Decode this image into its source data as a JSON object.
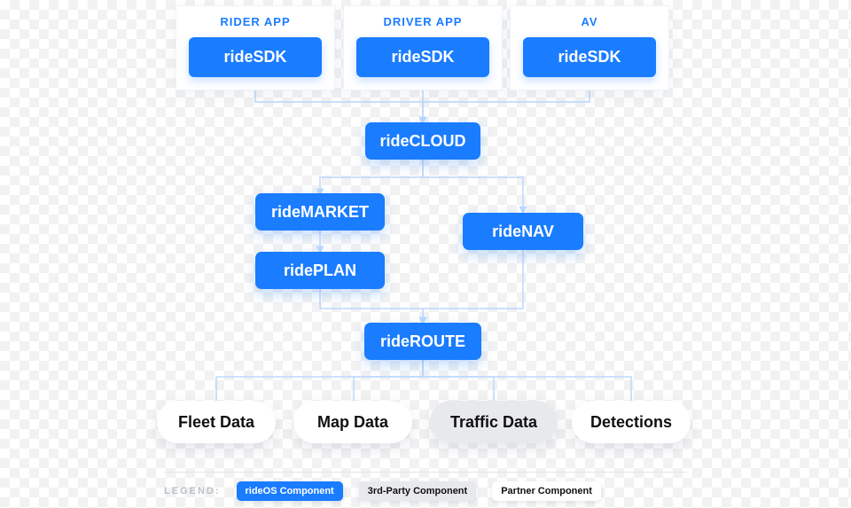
{
  "colors": {
    "primary": "#1a7cff",
    "connector": "#bcd8ff",
    "pillMuted": "#e8e9ec"
  },
  "apps": {
    "rider": {
      "title": "RIDER APP",
      "sdk": "rideSDK"
    },
    "driver": {
      "title": "DRIVER APP",
      "sdk": "rideSDK"
    },
    "av": {
      "title": "AV",
      "sdk": "rideSDK"
    }
  },
  "nodes": {
    "cloud": "rideCLOUD",
    "market": "rideMARKET",
    "plan": "ridePLAN",
    "nav": "rideNAV",
    "route": "rideROUTE"
  },
  "pills": {
    "fleet": "Fleet Data",
    "map": "Map Data",
    "traffic": "Traffic Data",
    "detections": "Detections"
  },
  "legend": {
    "label": "LEGEND:",
    "rideos": "rideOS Component",
    "third": "3rd-Party Component",
    "partner": "Partner Component"
  }
}
